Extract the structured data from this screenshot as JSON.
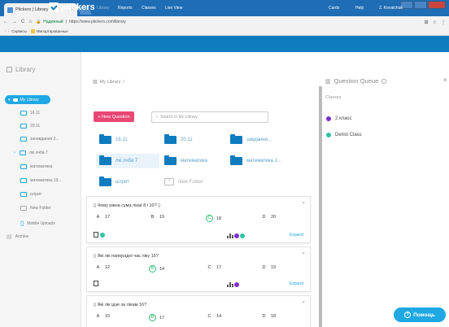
{
  "browser": {
    "tab_title": "Plickers | Library",
    "secure_label": "Надежный",
    "url": "https://www.plickers.com/library",
    "bookmarks": [
      {
        "label": "Сервисы"
      },
      {
        "label": "Импортированные"
      }
    ]
  },
  "nav": {
    "logo": "plickers",
    "links": [
      {
        "label": "Library"
      },
      {
        "label": "Reports"
      },
      {
        "label": "Classes"
      },
      {
        "label": "Live View"
      }
    ],
    "right_links": [
      {
        "label": "Cards"
      },
      {
        "label": "Help"
      },
      {
        "label": "Z. Kovalchuk"
      }
    ]
  },
  "sidebar": {
    "title": "Library",
    "my_library": "My Library",
    "items": [
      {
        "label": "16.11"
      },
      {
        "label": "20.11"
      },
      {
        "label": "занавдання 2..."
      },
      {
        "label": "лкі лчба 7"
      },
      {
        "label": "математика"
      },
      {
        "label": "математика 19..."
      },
      {
        "label": "штрит"
      },
      {
        "label": "New Folder"
      },
      {
        "label": "Mobile Uploads"
      },
      {
        "label": "Archive"
      }
    ]
  },
  "main": {
    "breadcrumb": "My Library",
    "breadcrumb_sep": "/",
    "new_question": "+ New Question",
    "search_placeholder": "Search in My Library",
    "folders": [
      {
        "label": "16.11"
      },
      {
        "label": "20.11"
      },
      {
        "label": "завдання..."
      },
      {
        "label": "лкі лчба 7"
      },
      {
        "label": "математика"
      },
      {
        "label": "математика 1..."
      },
      {
        "label": "штрит"
      }
    ],
    "new_folder": "New Folder",
    "expand_label": "Expand",
    "questions": [
      {
        "title": "Чому рівна сума лікаї 8 і 10? ",
        "answers": [
          {
            "letter": "A",
            "value": "17",
            "correct": false
          },
          {
            "letter": "B",
            "value": "19",
            "correct": false
          },
          {
            "letter": "C",
            "value": "18",
            "correct": true
          },
          {
            "letter": "D",
            "value": "20",
            "correct": false
          }
        ]
      },
      {
        "title": "Які лік паперадні чає ліку 15?",
        "answers": [
          {
            "letter": "A",
            "value": "12",
            "correct": false
          },
          {
            "letter": "B",
            "value": "14",
            "correct": true
          },
          {
            "letter": "C",
            "value": "17",
            "correct": false
          },
          {
            "letter": "D",
            "value": "19",
            "correct": false
          }
        ]
      },
      {
        "title": "Які лік ідзе за лікам 16?",
        "answers": [
          {
            "letter": "A",
            "value": "15",
            "correct": false
          },
          {
            "letter": "B",
            "value": "17",
            "correct": true
          },
          {
            "letter": "C",
            "value": "14",
            "correct": false
          },
          {
            "letter": "D",
            "value": "18",
            "correct": false
          }
        ]
      }
    ]
  },
  "queue": {
    "title": "Question Queue",
    "classes_label": "Classes",
    "classes": [
      {
        "label": "2 класс",
        "color": "#7b2fd0"
      },
      {
        "label": "Demo Class",
        "color": "#2ec4a6"
      }
    ]
  },
  "help_button": "Помощь",
  "colors": {
    "brand": "#0e7cbf",
    "accent": "#1fa8e3",
    "new_question": "#e84774",
    "correct": "#2eb872"
  }
}
